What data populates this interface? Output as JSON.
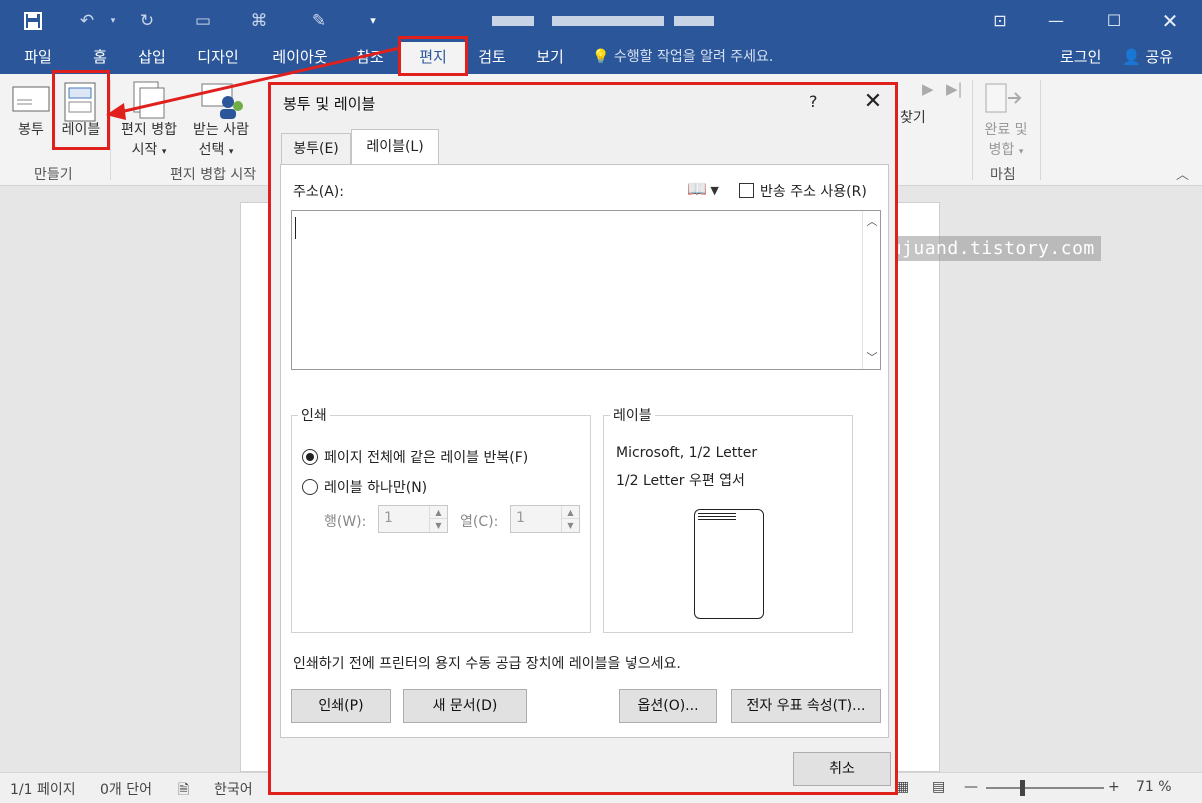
{
  "titlebar": {
    "qat": [
      "save-icon",
      "undo-icon",
      "redo-icon",
      "touch-mode-icon",
      "macro-icon",
      "format-painter-icon",
      "customize-qat-icon"
    ],
    "window_buttons": [
      "ribbon-display-icon",
      "minimize-icon",
      "maximize-icon",
      "close-icon"
    ]
  },
  "tabs": [
    "파일",
    "홈",
    "삽입",
    "디자인",
    "레이아웃",
    "참조",
    "편지",
    "검토",
    "보기"
  ],
  "selected_tab": "편지",
  "tell_me": "수행할 작업을 알려 주세요.",
  "account": {
    "login": "로그인",
    "share": "공유"
  },
  "ribbon": {
    "create": {
      "envelope": "봉투",
      "labels": "레이블",
      "group": "만들기"
    },
    "mail_merge": {
      "start_line1": "편지 병합",
      "start_line2": "시작",
      "select_line1": "받는 사람",
      "select_line2": "선택",
      "group": "편지 병합 시작"
    },
    "finish": {
      "line1": "완료 및",
      "line2": "병합",
      "group": "마침"
    },
    "find_partial": "찾기"
  },
  "dialog": {
    "title": "봉투 및 레이블",
    "help": "?",
    "tabs": {
      "envelope": "봉투(E)",
      "labels": "레이블(L)"
    },
    "address_label": "주소(A):",
    "address_value": "",
    "return_address": "반송 주소 사용(R)",
    "print": {
      "legend": "인쇄",
      "full_page": "페이지 전체에 같은 레이블 반복(F)",
      "single": "레이블 하나만(N)",
      "row_label": "행(W):",
      "row_value": "1",
      "col_label": "열(C):",
      "col_value": "1"
    },
    "label": {
      "legend": "레이블",
      "vendor": "Microsoft, 1/2 Letter",
      "product": "1/2 Letter 우편 엽서"
    },
    "hint": "인쇄하기 전에 프린터의 용지 수동 공급 장치에 레이블을 넣으세요.",
    "buttons": {
      "print": "인쇄(P)",
      "new_document": "새 문서(D)",
      "options": "옵션(O)...",
      "epostage": "전자 우표 속성(T)...",
      "cancel": "취소"
    }
  },
  "watermark": "http://jujuand.tistory.com",
  "statusbar": {
    "page": "1/1 페이지",
    "words": "0개 단어",
    "language": "한국어",
    "zoom": "71 %"
  }
}
